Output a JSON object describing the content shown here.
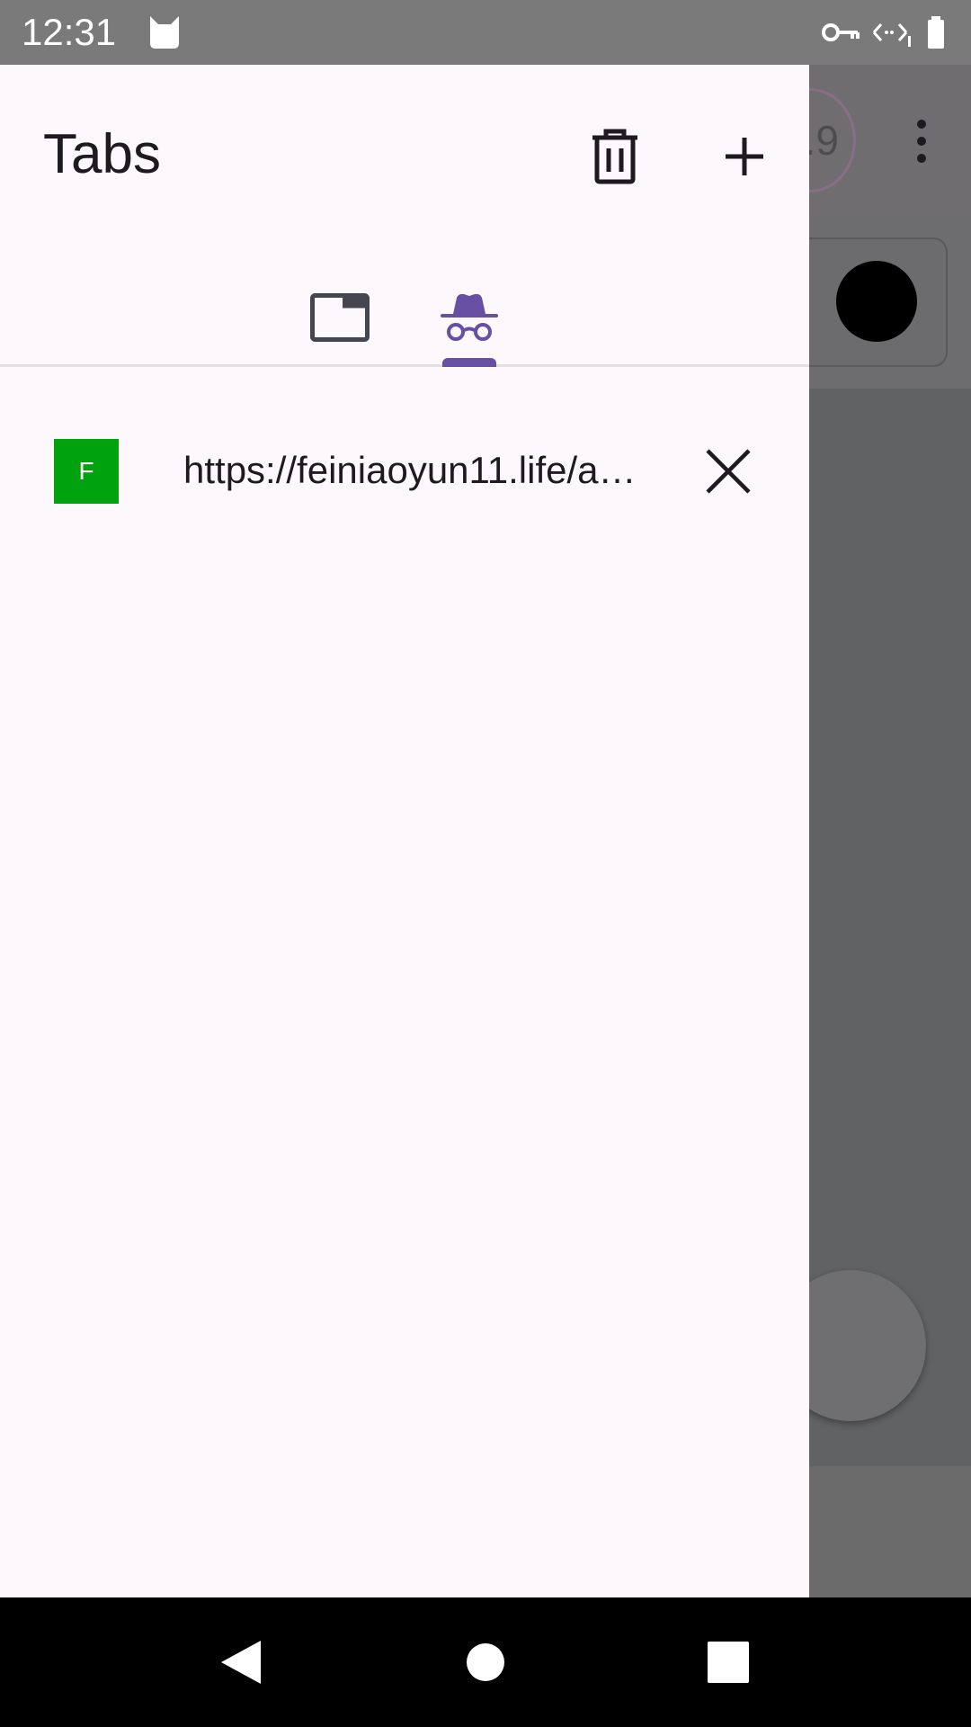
{
  "status_bar": {
    "time": "12:31",
    "icons": [
      "cat-icon",
      "vpn-key-icon",
      "data-saver-icon",
      "battery-icon"
    ]
  },
  "background_browser": {
    "avatar_text": "4.9",
    "menu_icon": "more-vert-icon"
  },
  "drawer": {
    "title": "Tabs",
    "actions": [
      "delete-icon",
      "add-icon"
    ],
    "switcher": {
      "tabs": [
        "normal-tabs-icon",
        "private-tabs-icon"
      ],
      "selected": "private-tabs-icon",
      "accent": "#6750a4"
    },
    "tabs": [
      {
        "favicon_letter": "F",
        "favicon_color": "#00a30e",
        "url": "https://feiniaoyun11.life/a…"
      }
    ]
  },
  "nav_bar": {
    "buttons": [
      "back-icon",
      "home-icon",
      "recents-icon"
    ]
  }
}
